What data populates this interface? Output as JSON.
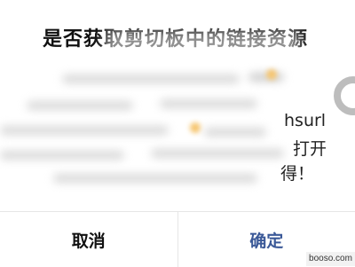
{
  "dialog": {
    "title": "是否获取剪切板中的链接资源",
    "visible_fragments": [
      "hsurl",
      "打开",
      "得！"
    ]
  },
  "buttons": {
    "cancel_label": "取消",
    "confirm_label": "确定"
  },
  "colors": {
    "confirm_text": "#3b5998",
    "cancel_text": "#111111",
    "divider": "#e6e6e6"
  },
  "watermark": {
    "text": "booso.com"
  }
}
